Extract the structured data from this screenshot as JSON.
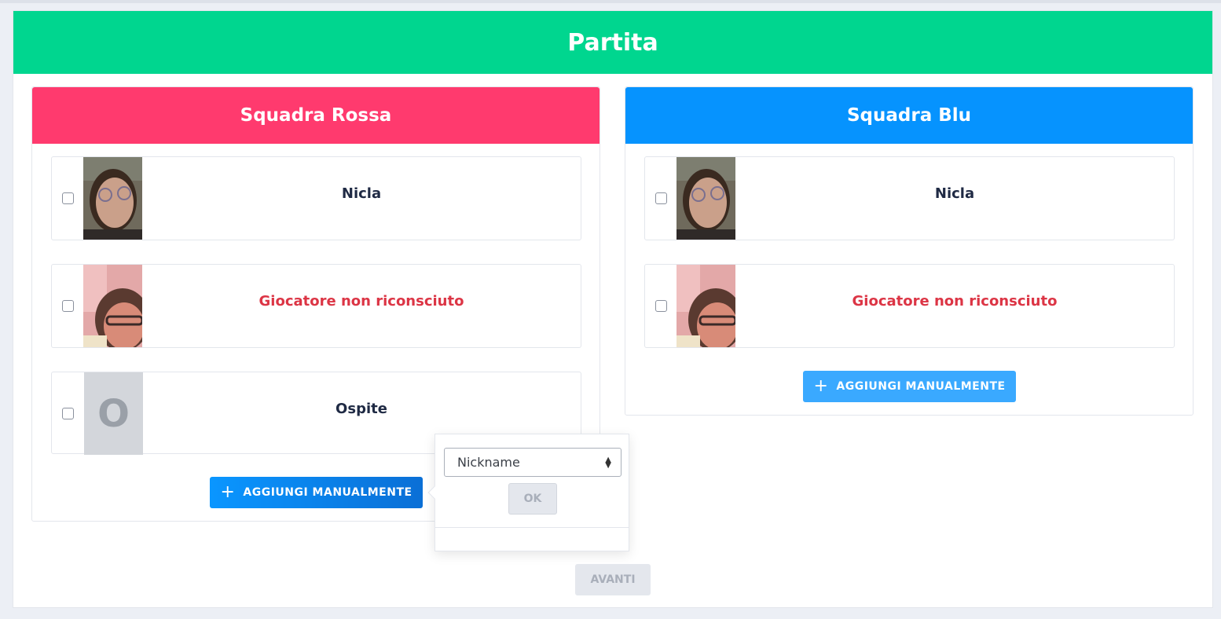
{
  "page": {
    "title": "Partita",
    "header_color": "#00d68f",
    "next_label": "AVANTI"
  },
  "teams": [
    {
      "name": "Squadra Rossa",
      "color": "#ff3a6e",
      "players": [
        {
          "name": "Nicla",
          "recognized": true
        },
        {
          "name": "Giocatore non riconsciuto",
          "recognized": false
        },
        {
          "name": "Ospite",
          "recognized": true,
          "initial": "O"
        }
      ],
      "add_label": "AGGIUNGI MANUALMENTE",
      "add_icon": "plus-icon"
    },
    {
      "name": "Squadra Blu",
      "color": "#0693fe",
      "players": [
        {
          "name": "Nicla",
          "recognized": true
        },
        {
          "name": "Giocatore non riconsciuto",
          "recognized": false
        }
      ],
      "add_label": "AGGIUNGI MANUALMENTE",
      "add_icon": "plus-icon"
    }
  ],
  "popover": {
    "select_value": "Nickname",
    "ok_label": "OK"
  },
  "colors": {
    "unknown_text": "#dc3545",
    "name_text": "#1f2a44",
    "red_btn_gradient_from": "#0a96ff",
    "red_btn_gradient_to": "#0a6fd6",
    "blue_btn": "#3aa9ff"
  }
}
